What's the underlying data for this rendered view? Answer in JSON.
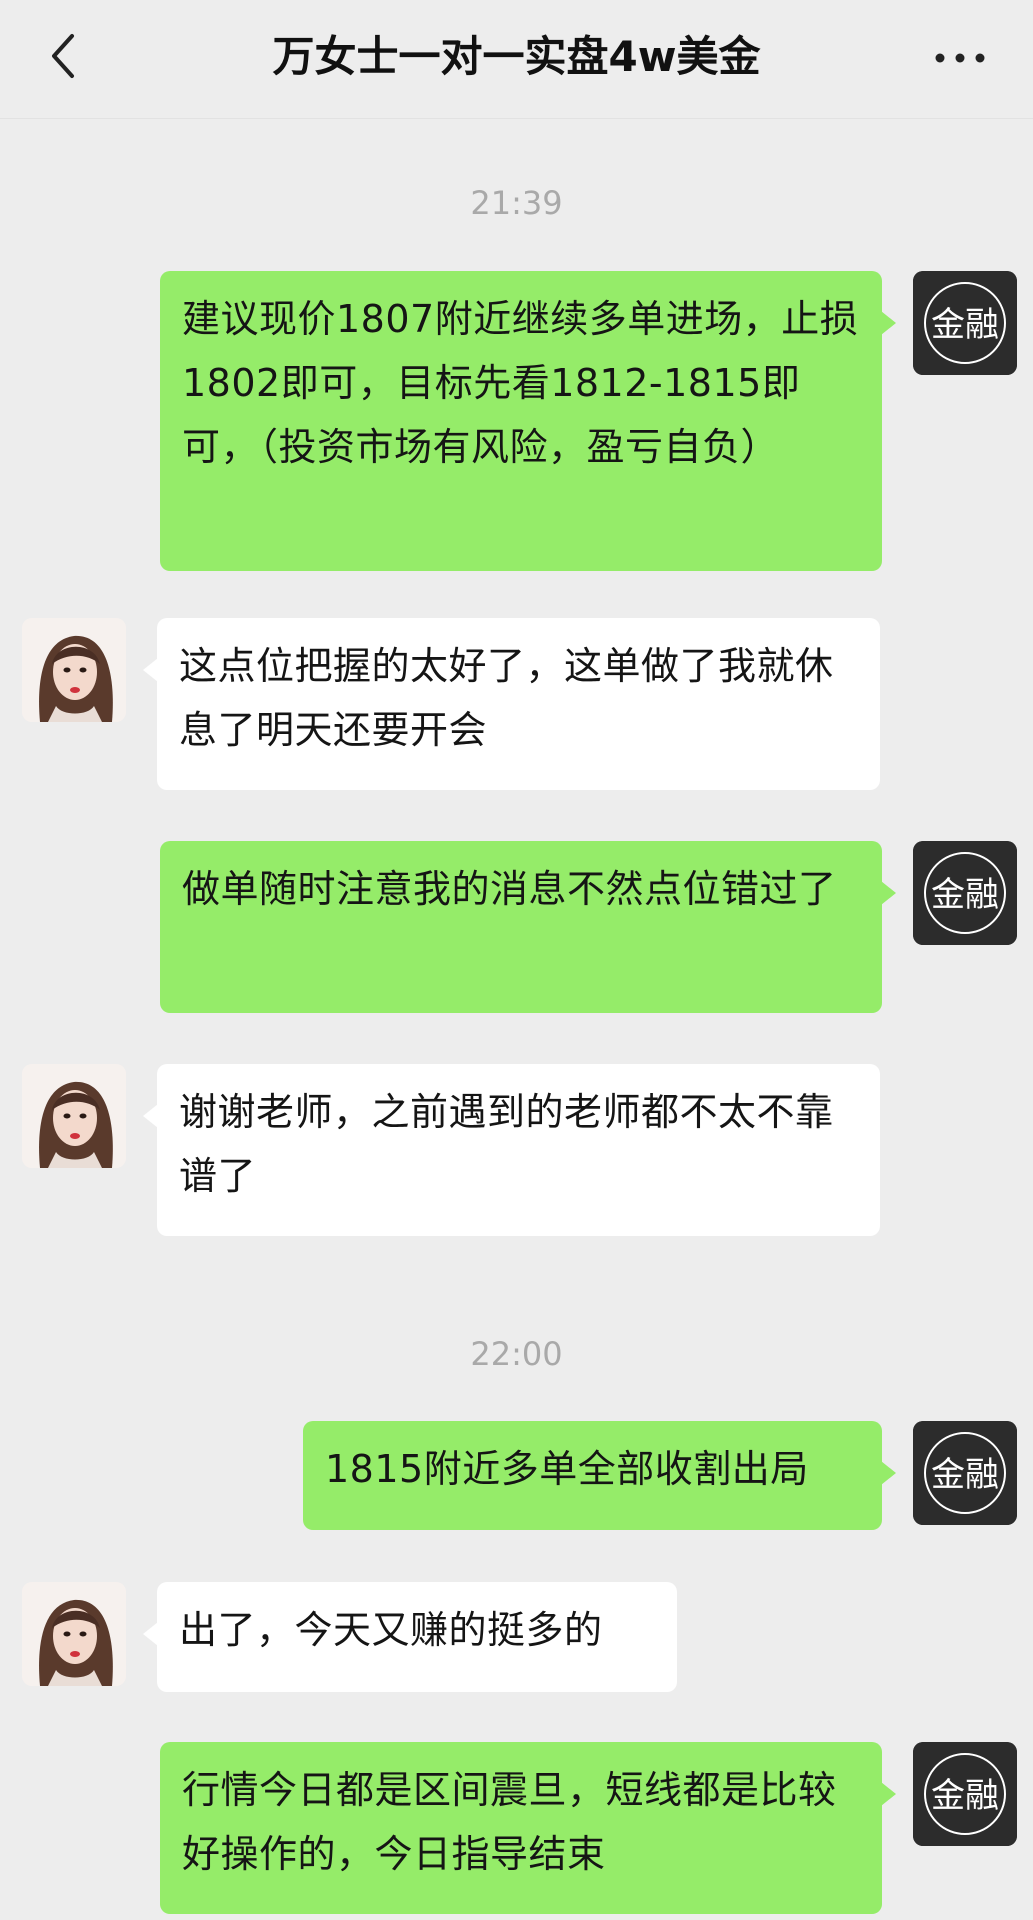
{
  "header": {
    "title": "万女士一对一实盘4w美金",
    "back_icon": "chevron-left-icon",
    "more_icon": "more-dots-icon"
  },
  "teacher_avatar": {
    "text": "金融",
    "bg_color": "#2c2c2c",
    "accent_color": "#e8b400"
  },
  "colors": {
    "my_bubble": "#95ec69",
    "their_bubble": "#ffffff",
    "background": "#ededed"
  },
  "messages": [
    {
      "type": "time",
      "text": "21:39"
    },
    {
      "type": "bubble",
      "sender": "teacher",
      "text": "建议现价1807附近继续多单进场，止损1802即可，目标先看1812-1815即可，（投资市场有风险，盈亏自负）"
    },
    {
      "type": "bubble",
      "sender": "client",
      "text": "这点位把握的太好了，这单做了我就休息了明天还要开会"
    },
    {
      "type": "bubble",
      "sender": "teacher",
      "text": "做单随时注意我的消息不然点位错过了"
    },
    {
      "type": "bubble",
      "sender": "client",
      "text": "谢谢老师，之前遇到的老师都不太不靠谱了"
    },
    {
      "type": "time",
      "text": "22:00"
    },
    {
      "type": "bubble",
      "sender": "teacher",
      "text": "1815附近多单全部收割出局"
    },
    {
      "type": "bubble",
      "sender": "client",
      "text": "出了，今天又赚的挺多的"
    },
    {
      "type": "bubble",
      "sender": "teacher",
      "text": "行情今日都是区间震旦，短线都是比较好操作的，今日指导结束"
    }
  ]
}
